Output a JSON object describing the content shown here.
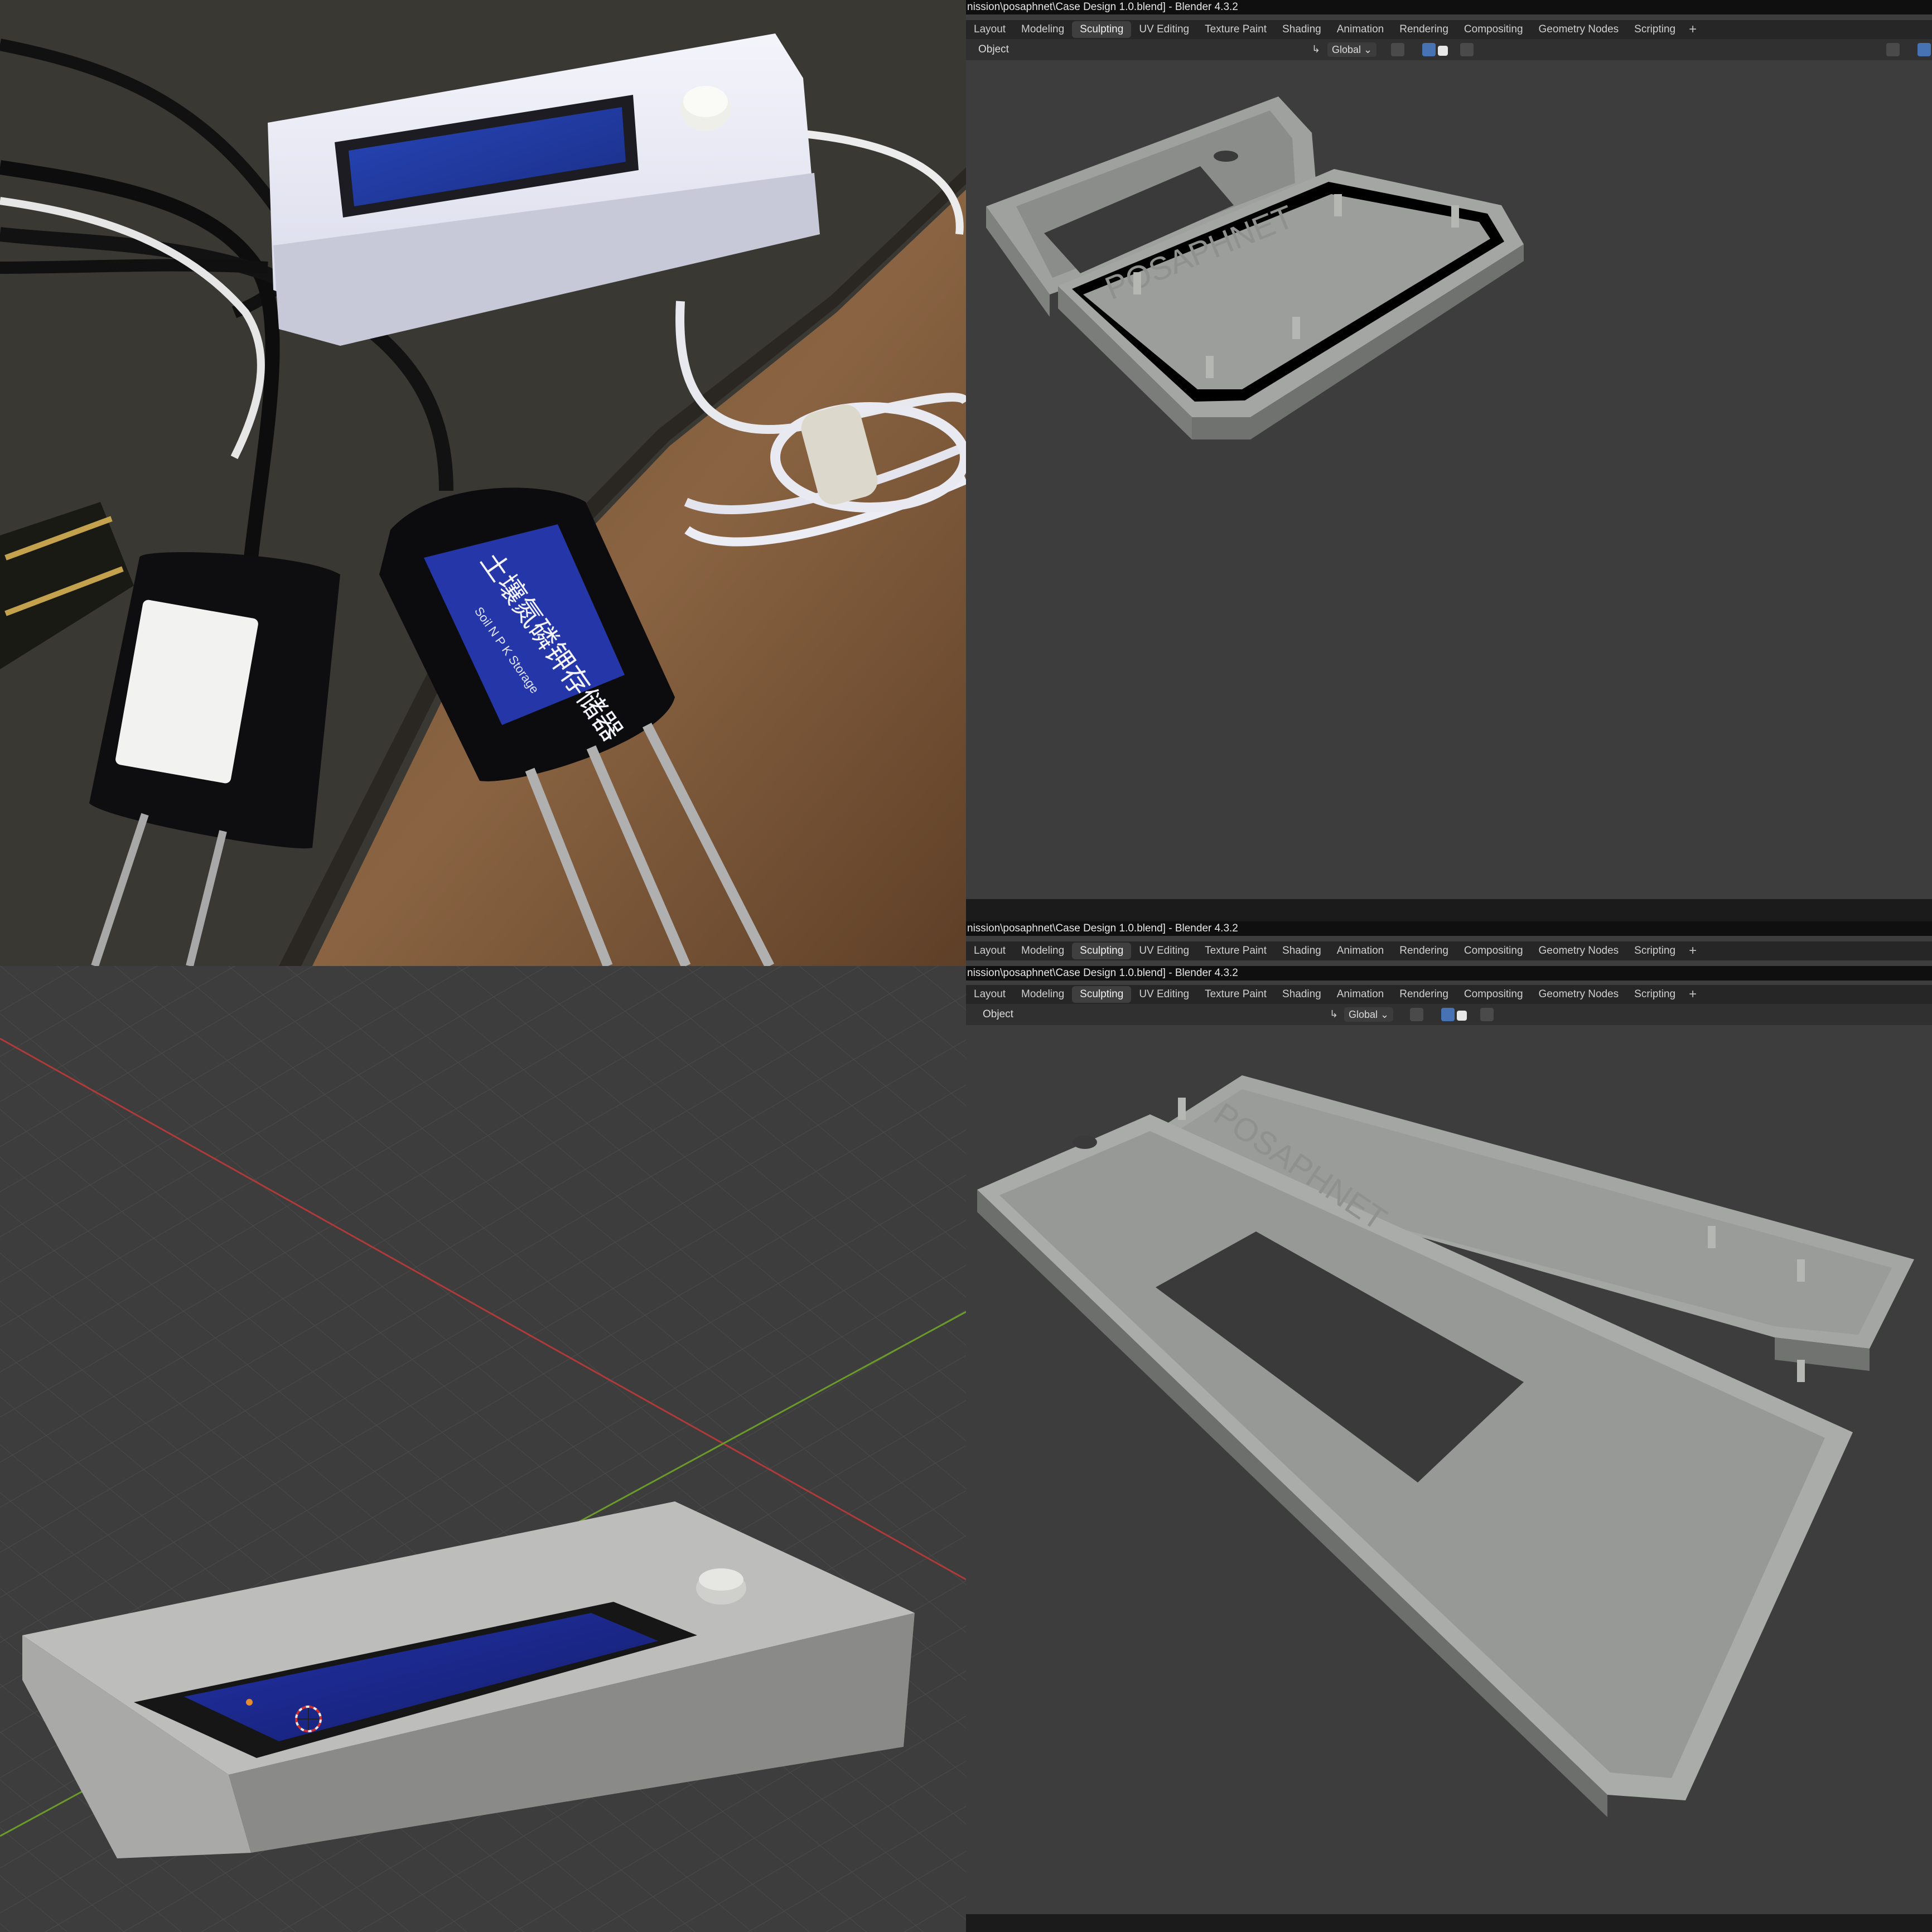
{
  "photo": {
    "sensor_label_title": "土壤氮磷钾存储器",
    "sensor_label_sub": "Soil N P K Storage"
  },
  "window_top": {
    "title": "nission\\posaphnet\\Case Design 1.0.blend] - Blender 4.3.2",
    "tabs": [
      "Layout",
      "Modeling",
      "Sculpting",
      "UV Editing",
      "Texture Paint",
      "Shading",
      "Animation",
      "Rendering",
      "Compositing",
      "Geometry Nodes",
      "Scripting"
    ],
    "active_tab": "Sculpting",
    "mode": "Object",
    "orientation": "Global"
  },
  "window_middle": {
    "title": "nission\\posaphnet\\Case Design 1.0.blend] - Blender 4.3.2",
    "tabs": [
      "Layout",
      "Modeling",
      "Sculpting",
      "UV Editing",
      "Texture Paint",
      "Shading",
      "Animation",
      "Rendering",
      "Compositing",
      "Geometry Nodes",
      "Scripting"
    ]
  },
  "window_bottom": {
    "title": "nission\\posaphnet\\Case Design 1.0.blend] - Blender 4.3.2",
    "tabs": [
      "Layout",
      "Modeling",
      "Sculpting",
      "UV Editing",
      "Texture Paint",
      "Shading",
      "Animation",
      "Rendering",
      "Compositing",
      "Geometry Nodes",
      "Scripting"
    ],
    "active_tab": "Sculpting",
    "mode": "Object",
    "orientation": "Global"
  },
  "colors": {
    "blender_bg": "#3d3d3d",
    "tab_active": "#3f3f3f",
    "accent_blue": "#4772b3",
    "lcd_blue": "#1e2f9e",
    "case_gray": "#9a9c98"
  }
}
